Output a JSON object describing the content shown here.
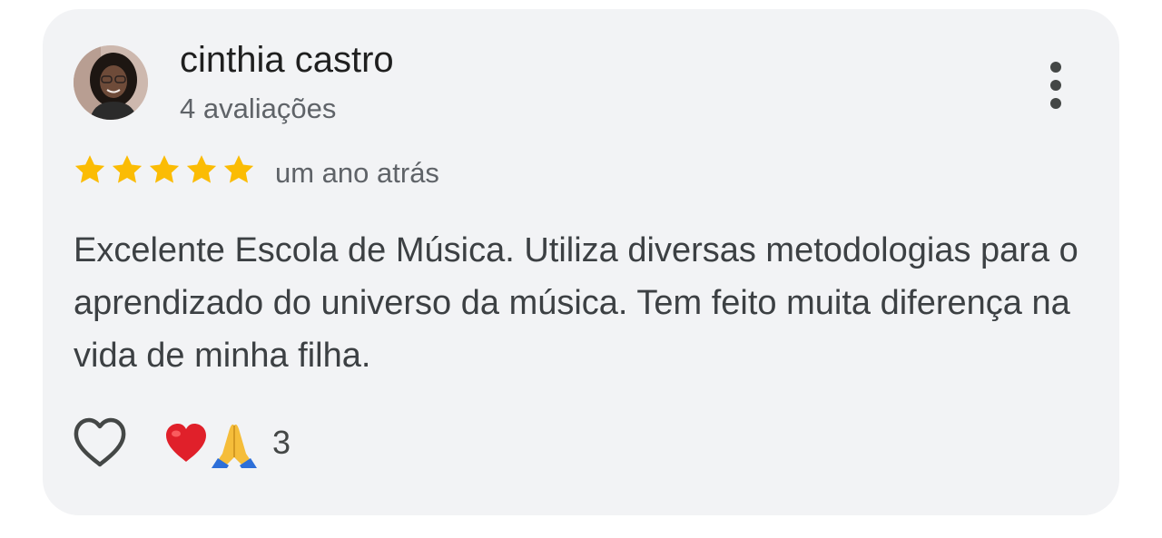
{
  "review": {
    "author": {
      "name": "cinthia castro",
      "reviews_count": "4 avaliações",
      "avatar": "profile-photo"
    },
    "rating": 5,
    "rating_max": 5,
    "time_ago": "um ano atrás",
    "text": "Excelente Escola de Música. Utiliza diversas metodologias para o aprendizado do universo da música. Tem feito muita diferença na vida de minha filha.",
    "actions": {
      "like_icon": "heart-outline-icon",
      "more_icon": "more-vert-icon"
    },
    "reactions": {
      "emojis": [
        "red-heart-emoji",
        "folded-hands-emoji"
      ],
      "count": "3"
    }
  },
  "colors": {
    "card_background": "#f2f3f5",
    "star": "#fbbc04",
    "primary_text": "#1f1f1f",
    "secondary_text": "#5f6368",
    "body_text": "#3c4043"
  }
}
